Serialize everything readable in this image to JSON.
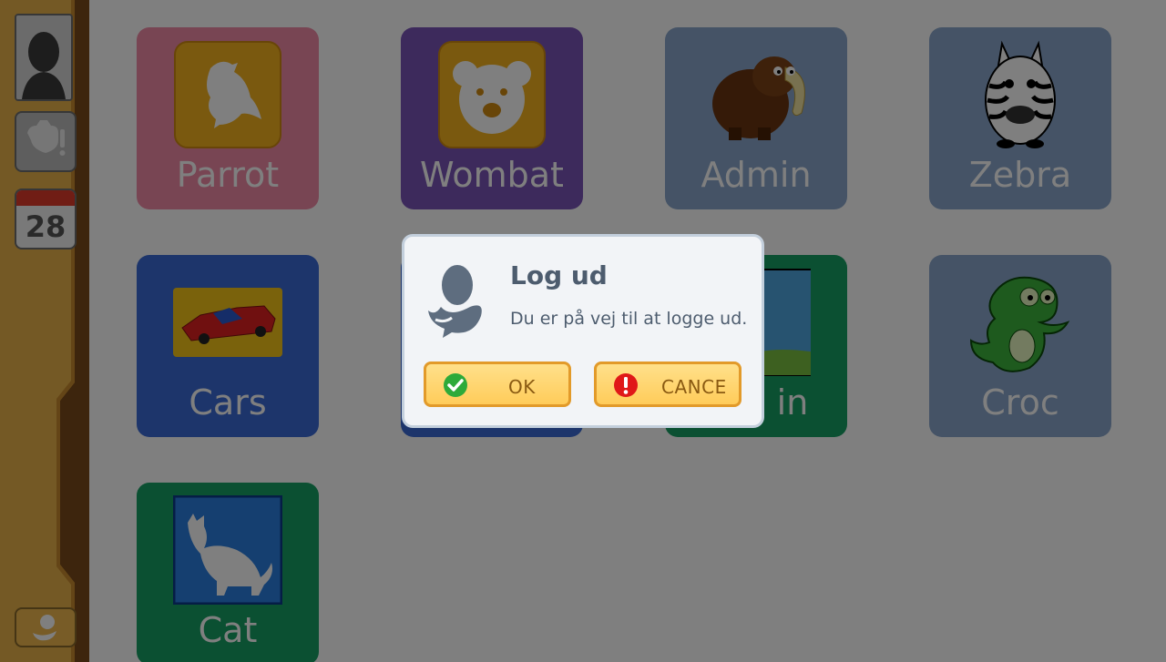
{
  "sidebar": {
    "calendar_day": "28",
    "icons": [
      "profile-icon",
      "tools-icon",
      "calendar-icon",
      "logout-icon"
    ]
  },
  "tiles": [
    {
      "label": "Parrot",
      "color": "#f08aa6",
      "icon": "parrot-icon"
    },
    {
      "label": "Wombat",
      "color": "#7b55b8",
      "icon": "wombat-icon"
    },
    {
      "label": "Admin",
      "color": "#8aa7cc",
      "icon": "mammoth-icon"
    },
    {
      "label": "Zebra",
      "color": "#8aa7cc",
      "icon": "zebra-icon"
    },
    {
      "label": "Cars",
      "color": "#3a6bd6",
      "icon": "car-icon"
    },
    {
      "label": "",
      "color": "#3a6bd6",
      "icon": "hidden-icon"
    },
    {
      "label": "in",
      "color": "#16a064",
      "icon": "drawing-icon"
    },
    {
      "label": "Croc",
      "color": "#8aa7cc",
      "icon": "croc-icon"
    },
    {
      "label": "Cat",
      "color": "#16a064",
      "icon": "cat-icon"
    }
  ],
  "dialog": {
    "title": "Log ud",
    "message": "Du er på vej til at logge ud.",
    "ok_label": "OK",
    "cancel_label": "CANCE"
  }
}
